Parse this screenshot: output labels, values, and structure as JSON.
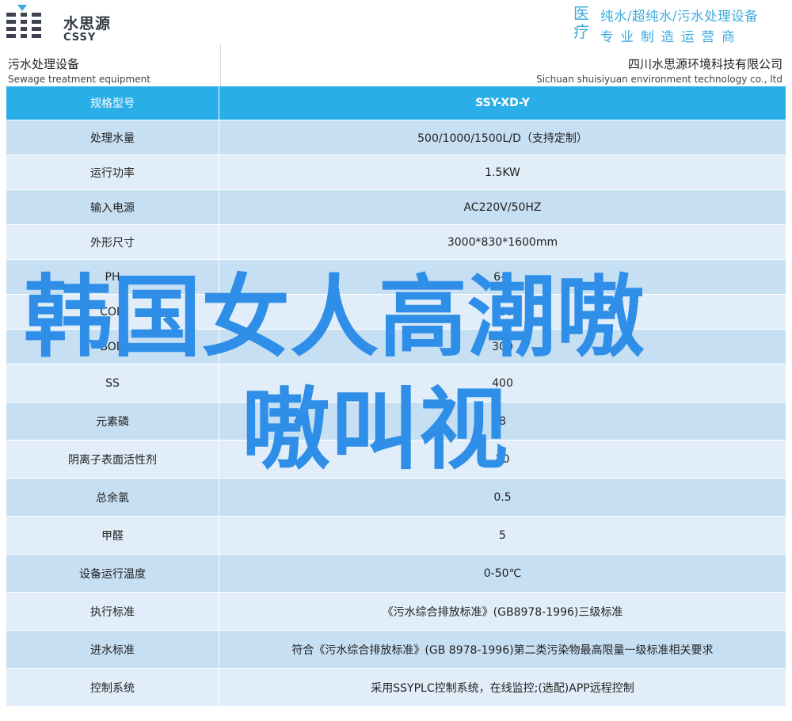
{
  "brand": {
    "name_cn": "水思源",
    "name_en": "CSSY",
    "logo_icon": "water-drop-logo-icon",
    "accent_color": "#3ba9df"
  },
  "slogan": {
    "big_chars": "医疗",
    "line1": "纯水/超纯水/污水处理设备",
    "line2": "专业制造运营商"
  },
  "header": {
    "left_cn": "污水处理设备",
    "left_en": "Sewage treatment equipment",
    "right_cn": "四川水思源环境科技有限公司",
    "right_en": "Sichuan shuisiyuan environment technology co., ltd"
  },
  "table": {
    "header_color": "#2aaee8",
    "rows": [
      {
        "label": "规格型号",
        "value": "SSY-XD-Y"
      },
      {
        "label": "处理水量",
        "value": "500/1000/1500L/D（支持定制）"
      },
      {
        "label": "运行功率",
        "value": "1.5KW"
      },
      {
        "label": "输入电源",
        "value": "AC220V/50HZ"
      },
      {
        "label": "外形尺寸",
        "value": "3000*830*1600mm"
      },
      {
        "label": "PH",
        "value": "6-9"
      },
      {
        "label": "COD",
        "value": "500"
      },
      {
        "label": "BOD",
        "value": "300"
      },
      {
        "label": "SS",
        "value": "400"
      },
      {
        "label": "元素磷",
        "value": "8"
      },
      {
        "label": "阴离子表面活性剂",
        "value": "20"
      },
      {
        "label": "总余氯",
        "value": "0.5"
      },
      {
        "label": "甲醛",
        "value": "5"
      },
      {
        "label": "设备运行温度",
        "value": "0-50℃"
      },
      {
        "label": "执行标准",
        "value": "《污水综合排放标准》(GB8978-1996)三级标准"
      },
      {
        "label": "进水标准",
        "value": "符合《污水综合排放标准》(GB 8978-1996)第二类污染物最高限量一级标准相关要求"
      },
      {
        "label": "控制系统",
        "value": "采用SSYPLC控制系统，在线监控;(选配)APP远程控制"
      }
    ]
  },
  "overlay": {
    "line1": "韩国女人高潮嗷",
    "line2": "嗷叫视",
    "color": "#2f8fe8"
  }
}
